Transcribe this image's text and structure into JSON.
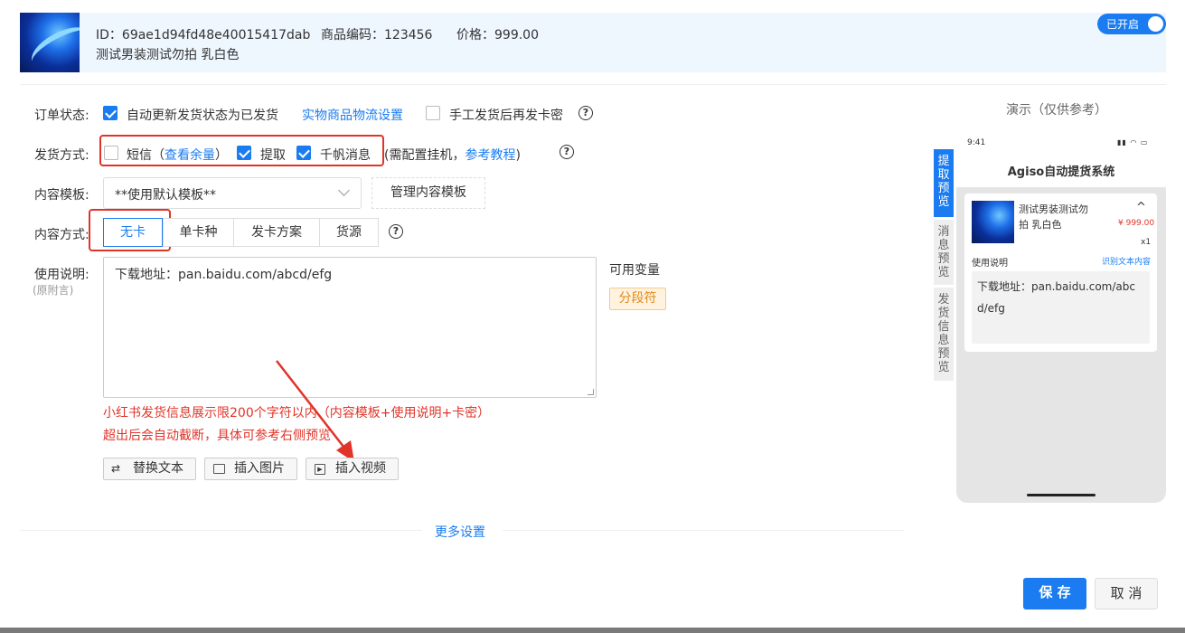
{
  "header": {
    "id_text": "ID：69ae1d94fd48e40015417dab",
    "code_text": "商品编码：123456",
    "price_text": "价格：999.00",
    "product_name": "测试男装测试勿拍 乳白色",
    "toggle_label": "已开启"
  },
  "order_status": {
    "label": "订单状态:",
    "auto_update_label": "自动更新发货状态为已发货",
    "logistics_link": "实物商品物流设置",
    "manual_label": "手工发货后再发卡密"
  },
  "delivery": {
    "label": "发货方式:",
    "sms_label": "短信（",
    "sms_link": "查看余量",
    "sms_close": "）",
    "pickup_label": "提取",
    "qianfan_label": "千帆消息",
    "note_prefix": "(需配置挂机，",
    "note_link": "参考教程",
    "note_suffix": ")"
  },
  "template": {
    "label": "内容模板:",
    "selected": "**使用默认模板**",
    "manage_button": "管理内容模板"
  },
  "content_mode": {
    "label": "内容方式:",
    "options": [
      "无卡",
      "单卡种",
      "发卡方案",
      "货源"
    ]
  },
  "instructions": {
    "label": "使用说明:",
    "sub_label": "(原附言)",
    "value": "下载地址：pan.baidu.com/abcd/efg",
    "variables_title": "可用变量",
    "variable_tag": "分段符",
    "warning_line1": "小红书发货信息展示限200个字符以内（内容模板+使用说明+卡密）",
    "warning_line2": "超出后会自动截断，具体可参考右侧预览"
  },
  "tools": {
    "replace_text": "替换文本",
    "insert_image": "插入图片",
    "insert_video": "插入视频"
  },
  "more_settings": "更多设置",
  "preview": {
    "title": "演示（仅供参考）",
    "tabs": [
      "提取预览",
      "消息预览",
      "发货信息预览"
    ],
    "time": "9:41",
    "app_title": "Agiso自动提货系统",
    "product_line1": "测试男装测试勿",
    "product_line2": "拍 乳白色",
    "price": "¥ 999.00",
    "qty": "x1",
    "instructions_label": "使用说明",
    "recognize_link": "识别文本内容",
    "content_line1": "下载地址：pan.baidu.com/abc",
    "content_line2": "d/efg"
  },
  "footer": {
    "save_label": "保 存",
    "cancel_label": "取 消"
  },
  "colors": {
    "accent": "#1a7cf0",
    "warning": "#e0342a",
    "tag_bg": "#fff3e0",
    "header_bg": "#eef6fe"
  }
}
